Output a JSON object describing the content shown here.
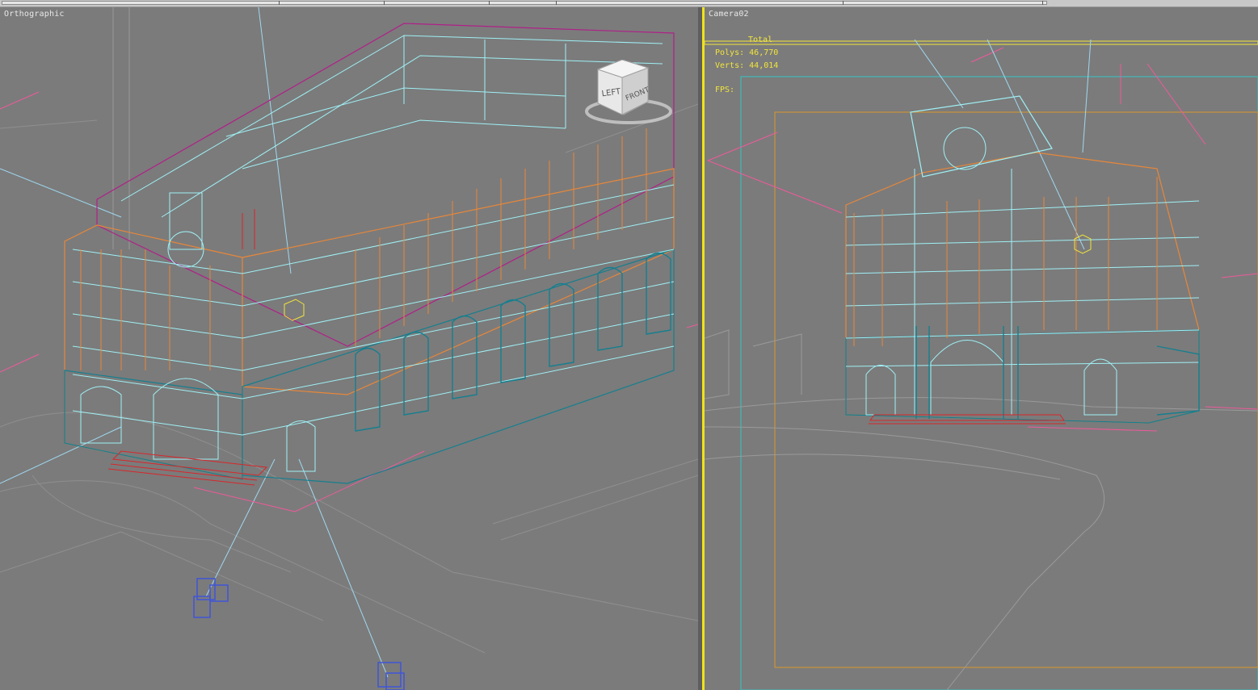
{
  "left_viewport": {
    "label": "Orthographic",
    "viewcube": {
      "left_face": "LEFT",
      "front_face": "FRONT"
    }
  },
  "right_viewport": {
    "label": "Camera02",
    "stats": {
      "total_label": "Total",
      "polys_label": "Polys:",
      "polys_value": "46,770",
      "verts_label": "Verts:",
      "verts_value": "44,014",
      "fps_label": "FPS:"
    }
  },
  "colors": {
    "background": "#7b7b7b",
    "active_border": "#f0e21a",
    "stats_text": "#f2e53a",
    "wire_cyan": "#9ff0f5",
    "wire_orange": "#e8873a",
    "wire_teal": "#157f8f",
    "wire_magenta": "#b02088",
    "wire_red": "#d8262a",
    "wire_pink": "#ef5a9a",
    "camera_blue": "#3f55d8"
  },
  "icons": [
    "viewcube-icon",
    "camera-icon",
    "target-icon"
  ]
}
